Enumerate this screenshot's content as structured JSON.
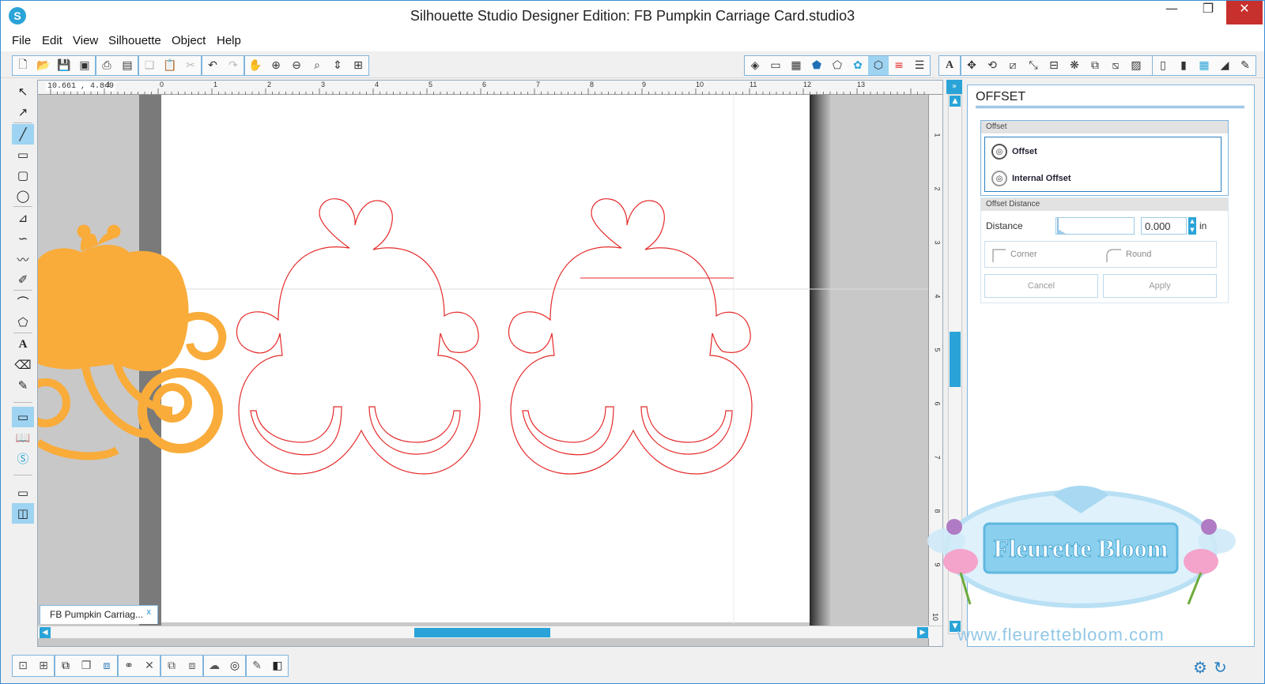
{
  "window": {
    "title": "Silhouette Studio Designer Edition: FB Pumpkin Carriage Card.studio3",
    "logo_glyph": "S",
    "min_glyph": "—",
    "max_glyph": "❐",
    "close_glyph": "✕"
  },
  "menu": [
    "File",
    "Edit",
    "View",
    "Silhouette",
    "Object",
    "Help"
  ],
  "toolbar": {
    "file_group": [
      "new-icon",
      "open-icon",
      "save-icon",
      "save-library-icon"
    ],
    "print_group": [
      "print-icon",
      "send-to-silhouette-icon"
    ],
    "clipboard_group": [
      "copy-icon",
      "paste-icon",
      "cut-icon"
    ],
    "undo_group": [
      "undo-icon",
      "redo-icon"
    ],
    "view_group": [
      "pan-icon",
      "zoom-in-icon",
      "zoom-out-icon",
      "zoom-select-icon",
      "drag-zoom-icon",
      "fit-to-page-icon"
    ],
    "panel_group": [
      "fill-icon",
      "page-setup-icon",
      "grid-icon",
      "fill-color-icon",
      "line-color-icon",
      "line-style-icon",
      "offset-icon",
      "cut-style-icon",
      "line-weight-icon"
    ],
    "text_glyph": "A",
    "tools_group": [
      "replicate-icon",
      "rotate-icon",
      "shear-icon",
      "scale-icon",
      "align-icon",
      "trace-icon",
      "modify-icon",
      "knife-icon",
      "library-icon",
      "store-icon"
    ],
    "send_group": [
      "cut-settings-icon",
      "send-icon",
      "print-cut-icon",
      "transform-icon",
      "sketch-icon",
      "media-icon"
    ]
  },
  "left_tools": [
    "select-icon",
    "point-edit-icon",
    "line-icon",
    "rectangle-icon",
    "rounded-rectangle-icon",
    "ellipse-icon",
    "polygon-icon",
    "curve-icon",
    "freehand-icon",
    "smooth-freehand-icon",
    "arc-icon",
    "regular-polygon-icon",
    "text-icon",
    "eraser-icon",
    "knife-tool-icon",
    "design-page-icon",
    "library-view-icon",
    "store-view-icon",
    "single-view-icon",
    "split-view-icon"
  ],
  "canvas": {
    "coordinates": "10.661 , 4.849",
    "ruler_h_labels": [
      "-1",
      "0",
      "1",
      "2",
      "3",
      "4",
      "5",
      "6",
      "7",
      "8",
      "9",
      "10",
      "11",
      "12",
      "13"
    ],
    "ruler_v_labels": [
      "1",
      "2",
      "3",
      "4",
      "5",
      "6",
      "7",
      "8",
      "9",
      "10"
    ],
    "tab_label": "FB Pumpkin Carriag...",
    "tab_close": "x",
    "colors": {
      "pumpkin": "#f9ac3a",
      "cut_line": "#e52a2a",
      "accent": "#2aa4d8"
    }
  },
  "panel": {
    "title": "OFFSET",
    "offset_section": "Offset",
    "offset_option": "Offset",
    "internal_offset_option": "Internal Offset",
    "distance_section": "Offset Distance",
    "distance_label": "Distance",
    "distance_value": "0.000",
    "distance_unit": "in",
    "corner_label": "Corner",
    "round_label": "Round",
    "cancel_label": "Cancel",
    "apply_label": "Apply"
  },
  "watermark": {
    "brand": "Fleurette Bloom",
    "url": "www.fleurettebloom.com"
  },
  "bottom_toolbar": {
    "group_icons": [
      "group-icon",
      "ungroup-icon",
      "compound-icon",
      "release-compound-icon",
      "bring-forward-icon",
      "send-backward-icon",
      "weld-icon",
      "delete-icon",
      "bring-to-front-icon",
      "send-to-back-icon",
      "duplicate-icon",
      "offset-shortcut-icon",
      "trace-shortcut-icon",
      "knife-shortcut-icon"
    ],
    "settings_glyph": "⚙",
    "sync_glyph": "↻"
  }
}
